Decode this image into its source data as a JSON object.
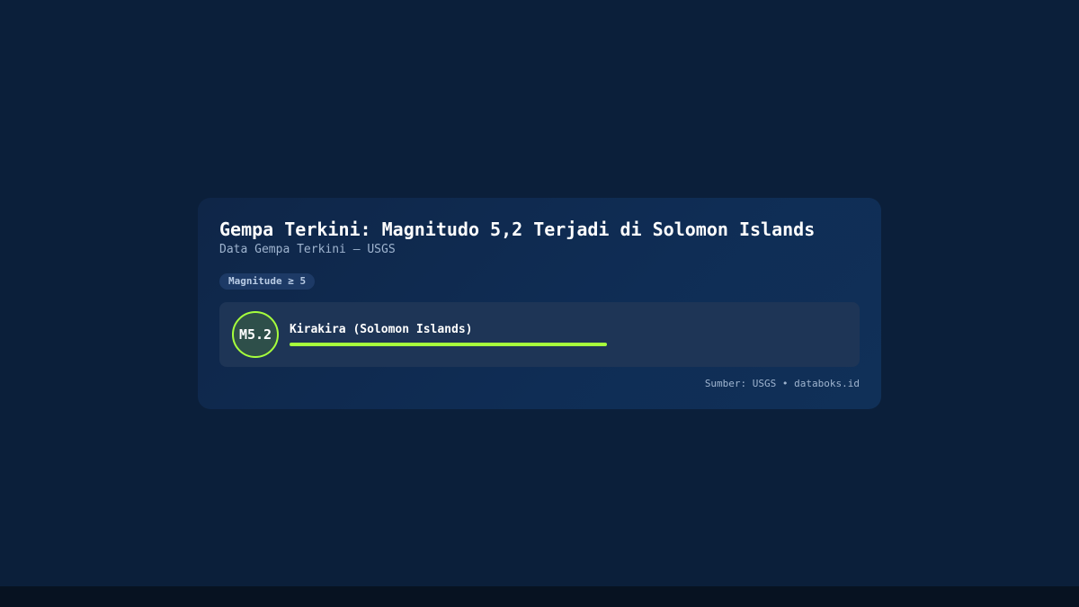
{
  "card": {
    "title": "Gempa Terkini: Magnitudo 5,2 Terjadi di Solomon Islands",
    "subtitle": "Data Gempa Terkini — USGS",
    "filter_badge": "Magnitude ≥ 5",
    "source": "Sumber: USGS • databoks.id"
  },
  "quake": {
    "magnitude_label": "M5.2",
    "magnitude": 5.2,
    "place": "Kirakira (Solomon Islands)",
    "bar_fraction": 0.588
  },
  "colors": {
    "background": "#0b1f3a",
    "card": "#0f2a50",
    "row": "#1e3556",
    "accent": "#a6ff3c",
    "text_muted": "#9fb4cf"
  },
  "icons": []
}
